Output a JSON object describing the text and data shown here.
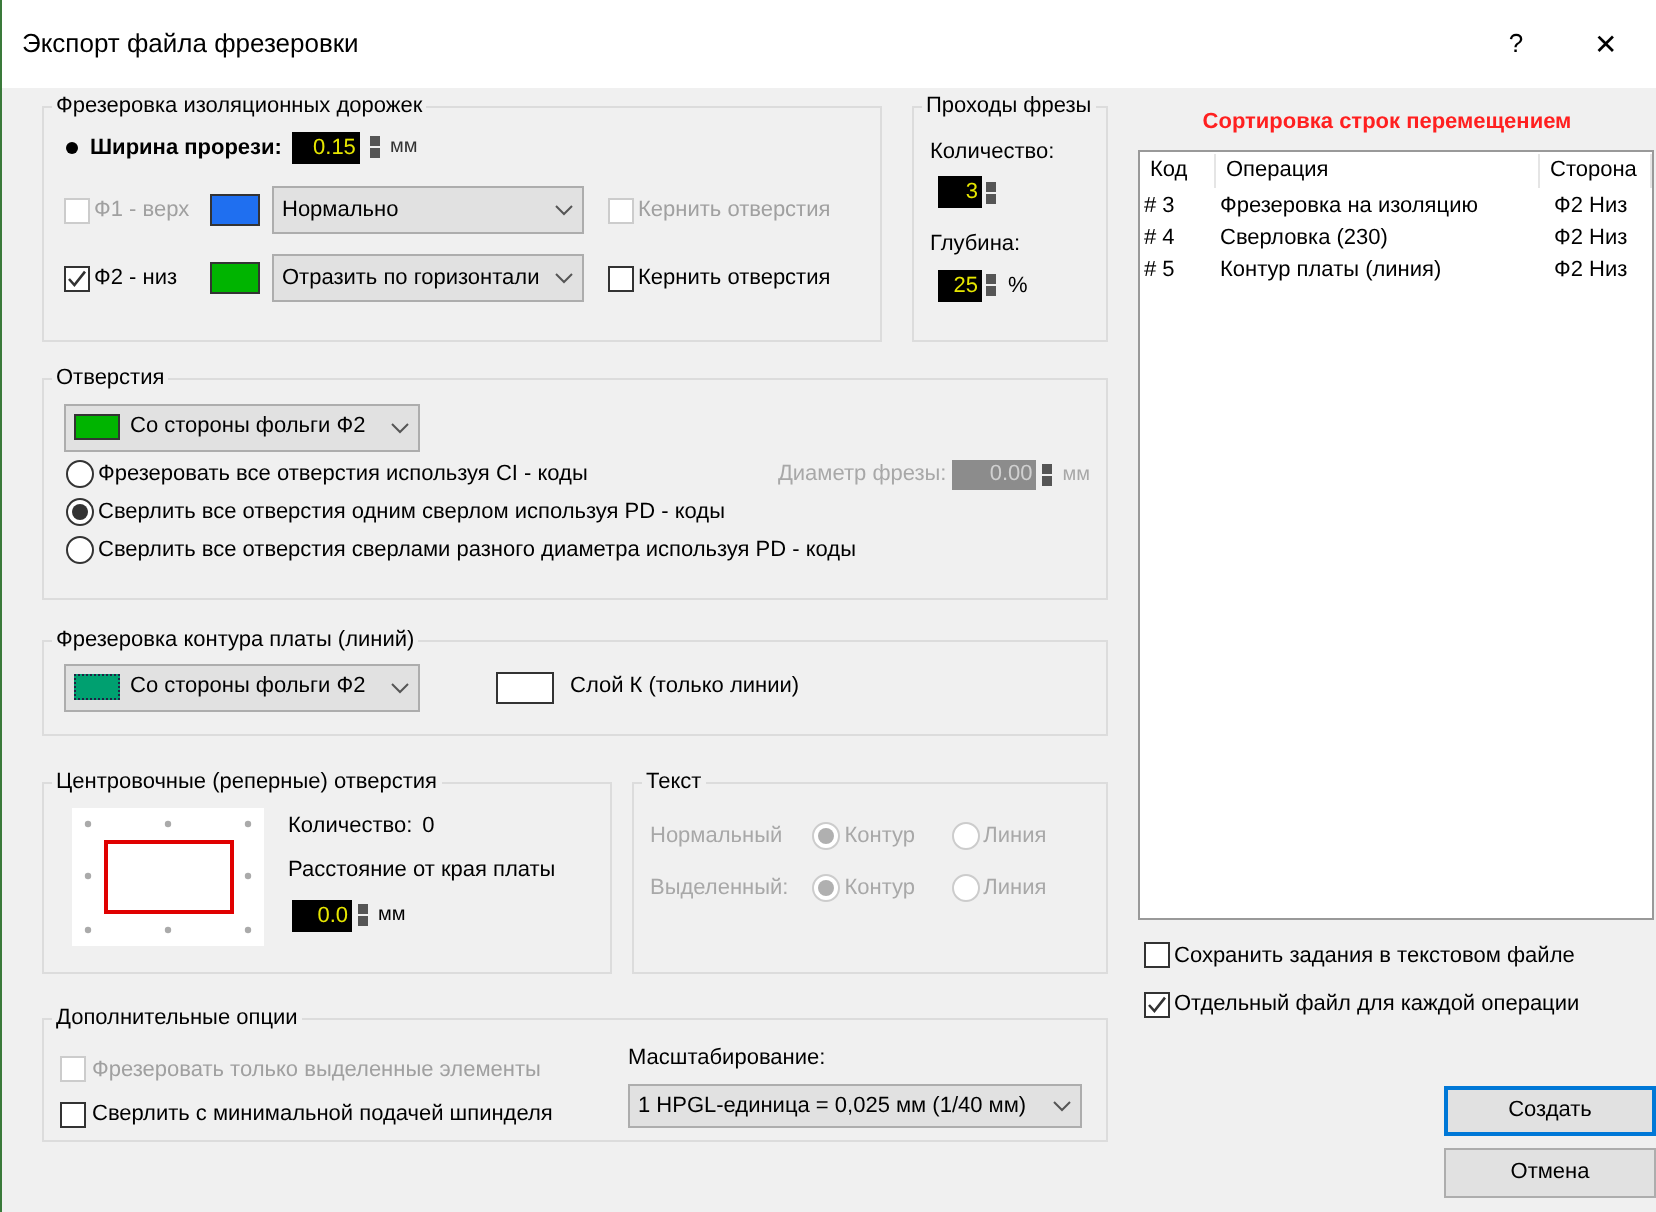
{
  "window": {
    "title": "Экспорт файла фрезеровки",
    "help": "?",
    "close": "✕"
  },
  "isolation": {
    "title": "Фрезеровка изоляционных дорожек",
    "width_label": "Ширина прорези:",
    "width_value": "0.15",
    "width_unit": "мм",
    "layers": [
      {
        "label": "Ф1 - верх",
        "checked": false,
        "disabled": true,
        "color": "#1f6ff0",
        "mode": "Нормально",
        "punch": {
          "label": "Кернить отверстия",
          "checked": false,
          "disabled": true
        }
      },
      {
        "label": "Ф2 - низ",
        "checked": true,
        "disabled": false,
        "color": "#00b400",
        "mode": "Отразить по горизонтали",
        "punch": {
          "label": "Кернить отверстия",
          "checked": false,
          "disabled": false
        }
      }
    ]
  },
  "passes": {
    "title": "Проходы фрезы",
    "count_label": "Количество:",
    "count": "3",
    "depth_label": "Глубина:",
    "depth": "25",
    "depth_unit": "%"
  },
  "holes": {
    "title": "Отверстия",
    "side": {
      "color": "#00b400",
      "value": "Со стороны фольги Ф2"
    },
    "diameter": {
      "label": "Диаметр фрезы:",
      "value": "0.00",
      "unit": "мм",
      "disabled": true
    },
    "options": [
      {
        "label": "Фрезеровать все отверстия используя CI - коды",
        "selected": false
      },
      {
        "label": "Сверлить все отверстия одним сверлом используя PD - коды",
        "selected": true
      },
      {
        "label": "Сверлить все отверстия сверлами разного диаметра используя PD - коды",
        "selected": false
      }
    ]
  },
  "outline": {
    "title": "Фрезеровка контура платы (линий)",
    "side": {
      "color": "#00a070",
      "value": "Со стороны фольги Ф2"
    },
    "layer_k": {
      "color": "#ffffff",
      "label": "Слой К (только линии)"
    }
  },
  "fiducials": {
    "title": "Центровочные (реперные) отверстия",
    "count_label": "Количество:",
    "count": "0",
    "distance_label": "Расстояние от края платы",
    "distance": "0.0",
    "unit": "мм"
  },
  "text": {
    "title": "Текст",
    "disabled": true,
    "rows": [
      {
        "label": "Нормальный",
        "options": [
          {
            "label": "Контур",
            "selected": true
          },
          {
            "label": "Линия",
            "selected": false
          }
        ]
      },
      {
        "label": "Выделенный:",
        "options": [
          {
            "label": "Контур",
            "selected": true
          },
          {
            "label": "Линия",
            "selected": false
          }
        ]
      }
    ]
  },
  "extra": {
    "title": "Дополнительные опции",
    "options": [
      {
        "label": "Фрезеровать только выделенные элементы",
        "checked": false,
        "disabled": true
      },
      {
        "label": "Сверлить с минимальной подачей шпинделя",
        "checked": false,
        "disabled": false
      }
    ],
    "scale_label": "Масштабирование:",
    "scale": "1 HPGL-единица = 0,025 мм (1/40 мм)"
  },
  "sort_title": "Сортировка строк перемещением",
  "table": {
    "columns": [
      "Код",
      "Операция",
      "Сторона"
    ],
    "rows": [
      [
        "# 3",
        "Фрезеровка на изоляцию",
        "Ф2 Низ"
      ],
      [
        "# 4",
        "Сверловка (230)",
        "Ф2 Низ"
      ],
      [
        "# 5",
        "Контур платы (линия)",
        "Ф2 Низ"
      ]
    ]
  },
  "save_options": [
    {
      "label": "Сохранить задания в текстовом файле",
      "checked": false
    },
    {
      "label": "Отдельный файл для каждой операции",
      "checked": true
    }
  ],
  "buttons": [
    {
      "label": "Создать",
      "default": true
    },
    {
      "label": "Отмена",
      "default": false
    }
  ]
}
